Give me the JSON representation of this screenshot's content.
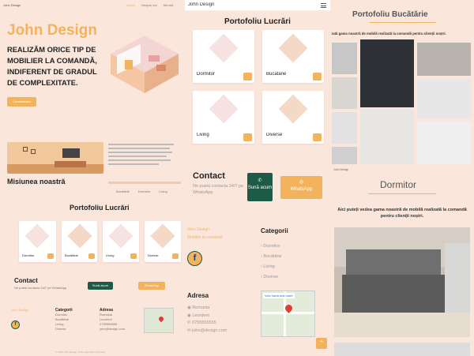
{
  "home": {
    "logo": "John Design",
    "nav": [
      "Acasă",
      "Despre noi",
      "Servicii"
    ],
    "hero_title": "John Design",
    "hero_text": "REALIZĂM ORICE TIP DE MOBILIER LA COMANDĂ, INDIFERENT DE GRADUL DE COMPLEXITATE.",
    "hero_button": "Contactează",
    "mission_title": "Misiunea noastră",
    "mission_links": [
      "Bucătărie",
      "Dormitor",
      "Living"
    ],
    "portfolio_title": "Portofoliu Lucrări",
    "portfolio_items": [
      "Dormitor",
      "Bucătărie",
      "Living",
      "Diverse"
    ],
    "contact_title": "Contact",
    "contact_text": "Ne puteți contacta 24/7 pe WhatsApp",
    "contact_btn1": "Sună acum",
    "contact_btn2": "WhatsApp",
    "footer_brand": "John Design",
    "footer_cols": [
      {
        "title": "Categorii",
        "items": [
          "Dormitor",
          "Bucătărie",
          "Living",
          "Diverse"
        ]
      },
      {
        "title": "Adresa",
        "items": [
          "Romania",
          "Leordeni",
          "0755555555",
          "john@design.com"
        ]
      }
    ],
    "copyright": "© 2024 John Design. Toate drepturile rezervate."
  },
  "middle": {
    "header_logo": "John Design",
    "menu_icon": "hamburger-icon",
    "portfolio_title": "Portofoliu Lucrări",
    "items": [
      "Dormitor",
      "Bucătărie",
      "Living",
      "Diverse"
    ],
    "contact_title": "Contact",
    "contact_text": "Ne puteți contacta 24/7 pe WhatsApp",
    "call_button": "Sună acum",
    "whatsapp_button": "WhatsApp",
    "footer_brand": "John Design",
    "footer_tagline": "Mobilier la comandă",
    "categories_title": "Categorii",
    "categories": [
      "Dormitor",
      "Bucătărie",
      "Living",
      "Diverse"
    ],
    "address_title": "Adresa",
    "address_lines": [
      "Romania",
      "Leordeni",
      "0755555555",
      "john@design.com"
    ],
    "map_label": "Vezi harta mai mare"
  },
  "right": {
    "title": "Portofoliu Bucătărie",
    "subtitle": "Iată gama noastră de mobilă realizată la comandă pentru clienții noștri.",
    "gallery_caption": "John Design",
    "section_title": "Dormitor",
    "section_text": "Aici puteți vedea gama noastră de mobilă realizată la comandă pentru clienții noștri."
  },
  "colors": {
    "bg": "#fbe6dc",
    "accent": "#f2b35c",
    "green": "#1d5b46"
  }
}
